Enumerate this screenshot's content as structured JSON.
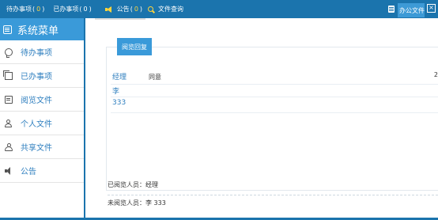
{
  "topbar": {
    "todo_label": "待办事项",
    "todo_count": "0",
    "done_label": "已办事项",
    "done_count": "0",
    "notice_label": "公告",
    "notice_count": "0",
    "search_label": "文件查询",
    "office_label": "办公文件"
  },
  "sidebar": {
    "title": "系统菜单",
    "items": [
      {
        "label": "待办事项",
        "icon": "chat-icon"
      },
      {
        "label": "已办事项",
        "icon": "copy-icon"
      },
      {
        "label": "阅览文件",
        "icon": "document-icon"
      },
      {
        "label": "个人文件",
        "icon": "user-icon"
      },
      {
        "label": "共享文件",
        "icon": "users-icon"
      },
      {
        "label": "公告",
        "icon": "speaker-icon"
      }
    ]
  },
  "panel": {
    "tab_label": "阅览回复",
    "rows": [
      {
        "name": "经理",
        "opinion": "同意",
        "date": "2"
      },
      {
        "name": "李",
        "opinion": "",
        "date": ""
      },
      {
        "name": "333",
        "opinion": "",
        "date": ""
      }
    ]
  },
  "readers": {
    "read": "已阅览人员：经理",
    "unread": "未阅览人员：李 333"
  },
  "colors": {
    "topbar": "#1b74ad",
    "accent": "#3a9ad9",
    "count": "#ffd43b",
    "link": "#2f7fbf"
  }
}
